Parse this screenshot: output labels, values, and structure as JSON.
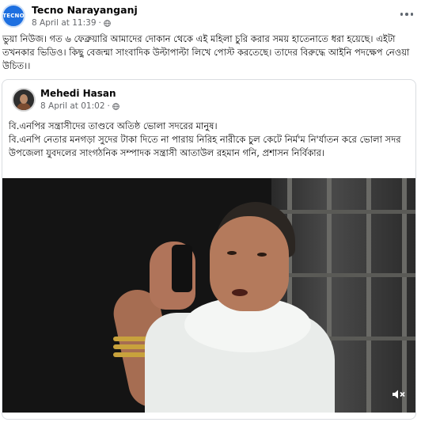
{
  "post": {
    "author": "Tecno Narayanganj",
    "avatar_text": "TECNO",
    "timestamp": "8 April at 11:39",
    "separator": "·",
    "text": "ভুয়া নিউজ। গত ৬ ফেব্রুয়ারি আমাদের দোকান থেকে এই মহিলা চুরি করার সময় হাতেনাতে ধরা হয়েছে। এইটা তখনকার ভিডিও। কিছু বেজন্মা সাংবাদিক উল্টাপাল্টা লিখে পোস্ট করতেছে। তাদের বিরুদ্ধে আইনি পদক্ষেপ নেওয়া উচিত।।"
  },
  "shared_post": {
    "author": "Mehedi Hasan",
    "timestamp": "8 April at 01:02",
    "separator": "·",
    "text": "বি.এনপির সন্ত্রাসীদের তাণ্ডবে অতিষ্ঠ ভোলা সদরের মানুষ।\nবি.এনপি নেতার মনগড়া সুদের টাকা দিতে না পারায় নিরিহ নারীকে চুল কেটে নির্ম'ম নি'র্যাতন করে ভোলা সদর উপজেলা যুবদলের সাংগঠনিক সম্পাদক সন্ত্রাসী  আতাউল রহমান গনি, প্রশাসন নির্বিকার।"
  },
  "icons": {
    "more": "more-horizontal-icon",
    "privacy": "globe-icon",
    "volume": "volume-muted-icon"
  },
  "colors": {
    "meta_text": "#65676b",
    "border": "#dadde1",
    "avatar_bg": "#1d6fe0"
  }
}
